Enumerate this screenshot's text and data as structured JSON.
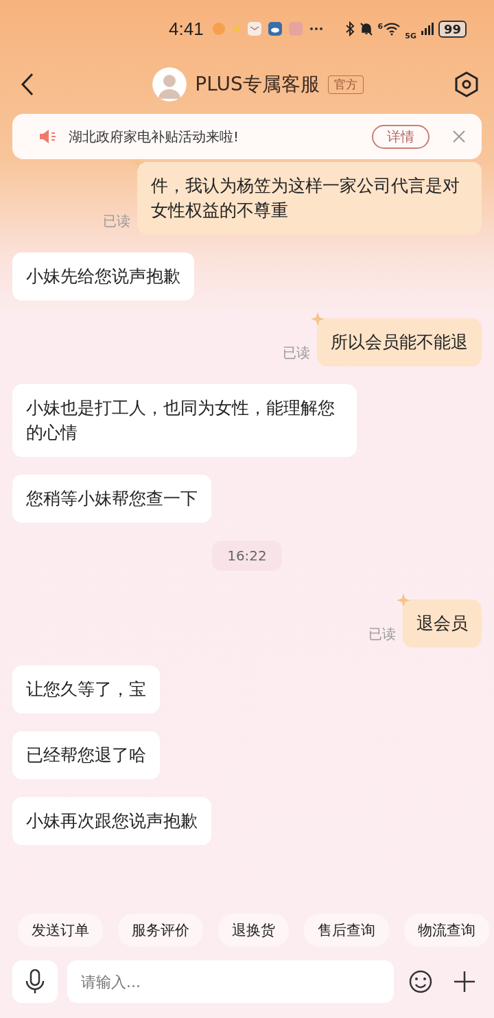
{
  "status_bar": {
    "time": "4:41",
    "network": "5G",
    "wifi_badge": "6",
    "battery": "99"
  },
  "header": {
    "title": "PLUS专属客服",
    "badge": "官方"
  },
  "notice": {
    "text": "湖北政府家电补贴活动来啦!",
    "button": "详情"
  },
  "messages": [
    {
      "kind": "outgoing",
      "text": "件，我认为杨笠为这样一家公司代言是对女性权益的不尊重",
      "read": "已读"
    },
    {
      "kind": "incoming",
      "text": "小妹先给您说声抱歉"
    },
    {
      "kind": "outgoing",
      "text": "所以会员能不能退",
      "read": "已读"
    },
    {
      "kind": "incoming",
      "text": "小妹也是打工人，也同为女性，能理解您的心情"
    },
    {
      "kind": "incoming",
      "text": "您稍等小妹帮您查一下"
    },
    {
      "kind": "time",
      "text": "16:22"
    },
    {
      "kind": "outgoing",
      "text": "退会员",
      "read": "已读"
    },
    {
      "kind": "incoming",
      "text": "让您久等了，宝"
    },
    {
      "kind": "incoming",
      "text": "已经帮您退了哈"
    },
    {
      "kind": "incoming",
      "text": "小妹再次跟您说声抱歉"
    }
  ],
  "quick_actions": [
    "发送订单",
    "服务评价",
    "退换货",
    "售后查询",
    "物流查询"
  ],
  "input": {
    "placeholder": "请输入..."
  }
}
